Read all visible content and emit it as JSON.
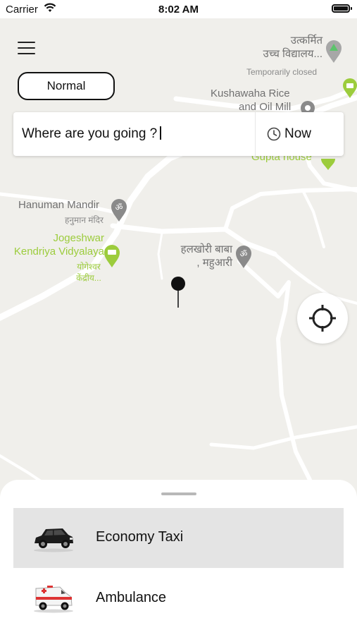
{
  "status_bar": {
    "carrier": "Carrier",
    "time": "8:02 AM"
  },
  "header": {
    "mode_label": "Normal"
  },
  "search": {
    "placeholder": "Where are you going ?",
    "when_label": "Now"
  },
  "map": {
    "pois": [
      {
        "lines": [
          "उत्कर्मित",
          "उच्च विद्यालय..."
        ],
        "sub": "Temporarily closed"
      },
      {
        "lines": [
          "Kushawaha Rice",
          "and Oil Mill"
        ]
      },
      {
        "lines": [
          "Gupta house"
        ]
      },
      {
        "lines": [
          "Hanuman Mandir"
        ],
        "sub": "हनुमान मंदिर"
      },
      {
        "lines": [
          "Jogeshwar",
          "Kendriya Vidyalaya"
        ],
        "sub": "योगेश्वर केंद्रीय..."
      },
      {
        "lines": [
          "हलखोरी बाबा",
          ", महुआरी"
        ]
      }
    ]
  },
  "rides": [
    {
      "label": "Economy Taxi",
      "icon": "car-icon",
      "selected": true
    },
    {
      "label": "Ambulance",
      "icon": "ambulance-icon",
      "selected": false
    }
  ],
  "colors": {
    "poi_green": "#9ccc3c",
    "poi_gray": "#707070",
    "selected_row": "#e4e4e4"
  }
}
